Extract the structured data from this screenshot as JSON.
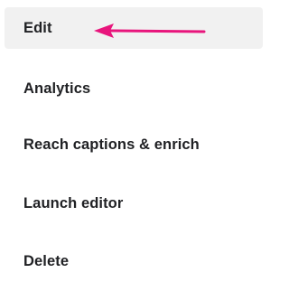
{
  "menu": {
    "items": [
      {
        "label": "Edit",
        "active": true
      },
      {
        "label": "Analytics",
        "active": false
      },
      {
        "label": "Reach captions & enrich",
        "active": false
      },
      {
        "label": "Launch editor",
        "active": false
      },
      {
        "label": "Delete",
        "active": false
      }
    ]
  },
  "annotation": {
    "icon": "arrow-left-icon",
    "color": "#e8157c"
  },
  "colors": {
    "active_background": "#f1f1f1",
    "text": "#202124"
  }
}
